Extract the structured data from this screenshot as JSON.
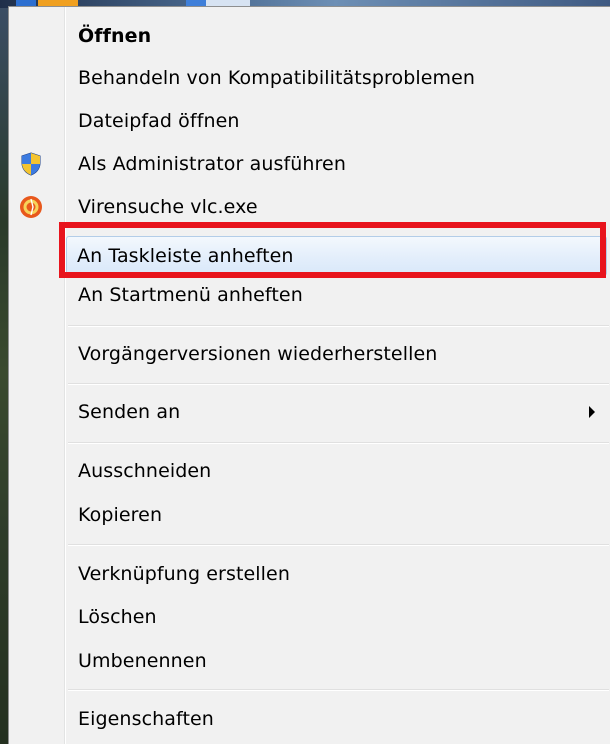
{
  "menu": {
    "items": [
      {
        "label": "Öffnen",
        "bold": true
      },
      {
        "label": "Behandeln von Kompatibilitätsproblemen"
      },
      {
        "label": "Dateipfad öffnen"
      },
      {
        "label": "Als Administrator ausführen",
        "icon": "uac-shield-icon"
      },
      {
        "label": "Virensuche vlc.exe",
        "icon": "antivirus-icon"
      },
      {
        "label": "An Taskleiste anheften",
        "highlighted": true
      },
      {
        "label": "An Startmenü anheften"
      },
      {
        "label": "Vorgängerversionen wiederherstellen"
      },
      {
        "label": "Senden an",
        "submenu": true
      },
      {
        "label": "Ausschneiden"
      },
      {
        "label": "Kopieren"
      },
      {
        "label": "Verknüpfung erstellen"
      },
      {
        "label": "Löschen"
      },
      {
        "label": "Umbenennen"
      },
      {
        "label": "Eigenschaften"
      }
    ]
  },
  "colors": {
    "menu_background": "#f1f1f1",
    "hover_background": "#dce9fa",
    "hover_border": "#b3cde8",
    "annotation_red": "#e8141d",
    "text": "#000000"
  }
}
